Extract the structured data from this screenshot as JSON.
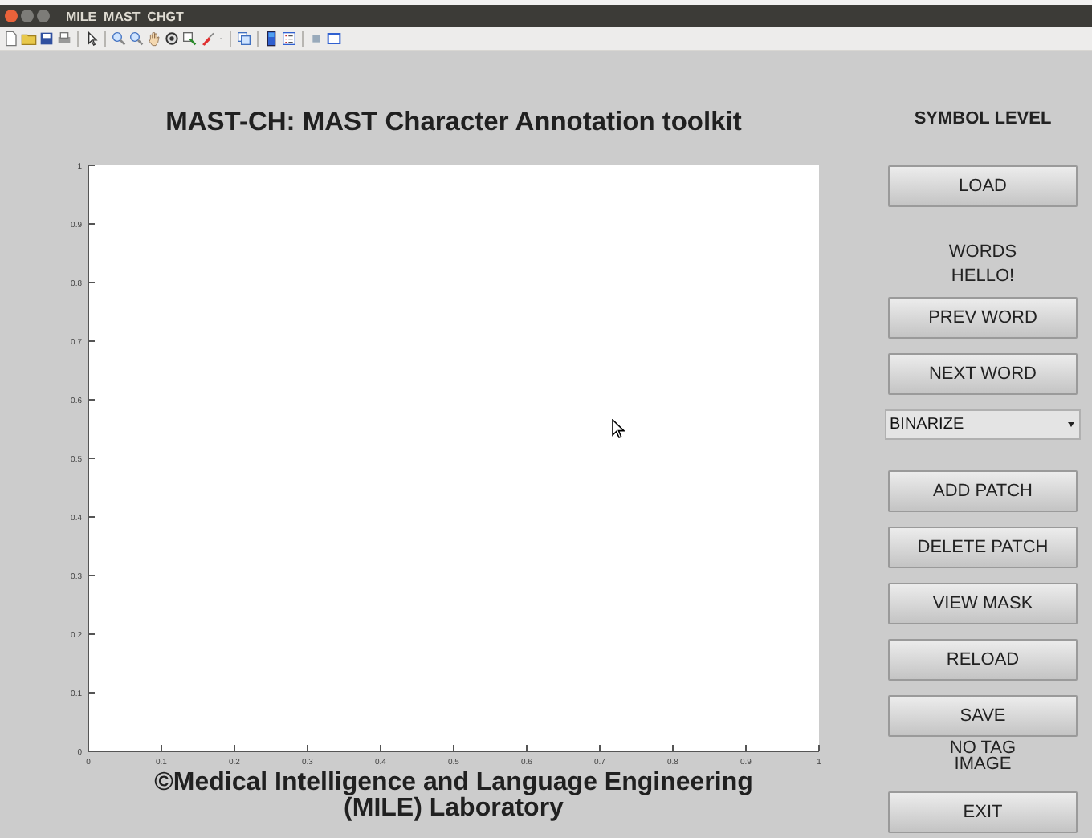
{
  "window": {
    "title": "MILE_MAST_CHGT"
  },
  "toolbar": [
    {
      "kind": "new"
    },
    {
      "kind": "open"
    },
    {
      "kind": "save"
    },
    {
      "kind": "print"
    },
    {
      "kind": "separator"
    },
    {
      "kind": "pointer"
    },
    {
      "kind": "separator"
    },
    {
      "kind": "zoom-in"
    },
    {
      "kind": "zoom-out"
    },
    {
      "kind": "pan"
    },
    {
      "kind": "rotate"
    },
    {
      "kind": "data-cursor"
    },
    {
      "kind": "brush"
    },
    {
      "kind": "dropdown"
    },
    {
      "kind": "separator"
    },
    {
      "kind": "link"
    },
    {
      "kind": "separator"
    },
    {
      "kind": "colorbar"
    },
    {
      "kind": "legend"
    },
    {
      "kind": "separator"
    },
    {
      "kind": "hide"
    },
    {
      "kind": "show"
    }
  ],
  "heading": "MAST-CH: MAST Character Annotation toolkit",
  "axes": {
    "xticks": [
      "0",
      "0.1",
      "0.2",
      "0.3",
      "0.4",
      "0.5",
      "0.6",
      "0.7",
      "0.8",
      "0.9",
      "1"
    ],
    "yticks": [
      "1",
      "0.9",
      "0.8",
      "0.7",
      "0.6",
      "0.5",
      "0.4",
      "0.3",
      "0.2",
      "0.1",
      "0"
    ]
  },
  "footer": [
    "©Medical Intelligence and Language Engineering",
    "(MILE) Laboratory"
  ],
  "panel": [
    {
      "kind": "heading",
      "text": "SYMBOL LEVEL"
    },
    {
      "kind": "button",
      "text": "LOAD"
    },
    {
      "kind": "status",
      "lines": [
        "WORDS",
        "HELLO!"
      ]
    },
    {
      "kind": "button",
      "text": "PREV WORD"
    },
    {
      "kind": "button",
      "text": "NEXT WORD"
    },
    {
      "kind": "select",
      "value": "BINARIZE"
    },
    {
      "kind": "button",
      "text": "ADD PATCH"
    },
    {
      "kind": "button",
      "text": "DELETE PATCH"
    },
    {
      "kind": "button",
      "text": "VIEW MASK"
    },
    {
      "kind": "button",
      "text": "RELOAD"
    },
    {
      "kind": "button",
      "text": "SAVE"
    },
    {
      "kind": "status",
      "lines": [
        "NO TAG IMAGE"
      ]
    },
    {
      "kind": "button",
      "text": "EXIT"
    }
  ]
}
